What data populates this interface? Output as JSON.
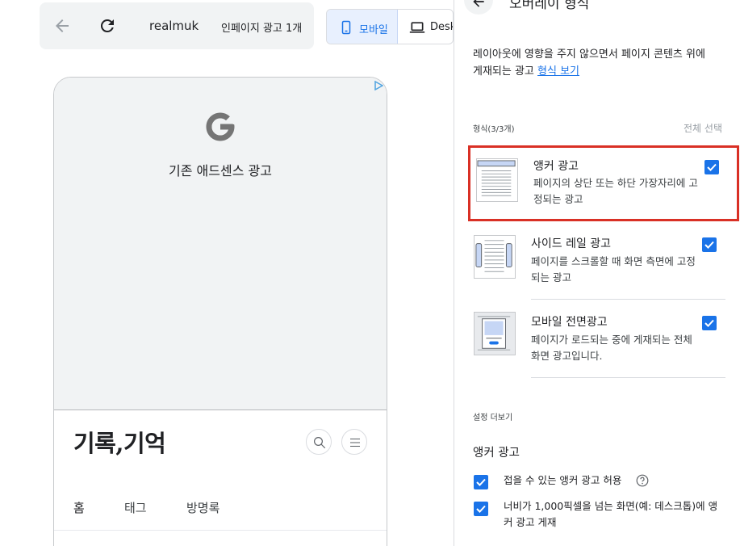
{
  "toolbar": {
    "site": "realmuk",
    "ad_count": "인페이지 광고 1개",
    "mobile_tab": "모바일",
    "desktop_tab": "Desk"
  },
  "preview": {
    "ad_label": "기존 애드센스 광고",
    "blog_title": "기록,기억",
    "nav": [
      "홈",
      "태그",
      "방명록"
    ]
  },
  "panel": {
    "title": "오버레이 형식",
    "desc_text": "레이아웃에 영향을 주지 않으면서 페이지 콘텐츠 위에 게재되는 광고",
    "desc_link": "형식 보기",
    "formats_count": "형식(3/3개)",
    "select_all": "전체 선택",
    "formats": [
      {
        "name": "앵커 광고",
        "desc": "페이지의 상단 또는 하단 가장자리에 고정되는 광고",
        "checked": true
      },
      {
        "name": "사이드 레일 광고",
        "desc": "페이지를 스크롤할 때 화면 측면에 고정되는 광고",
        "checked": true
      },
      {
        "name": "모바일 전면광고",
        "desc": "페이지가 로드되는 중에 게재되는 전체 화면 광고입니다.",
        "checked": true
      }
    ],
    "more_settings": "설정 더보기",
    "anchor_section": "앵커 광고",
    "options": [
      {
        "label": "접을 수 있는 앵커 광고 허용",
        "checked": true
      },
      {
        "label": "너비가 1,000픽셀을 넘는 화면(예: 데스크톱)에 앵커 광고 게재",
        "checked": true
      }
    ]
  },
  "colors": {
    "accent": "#1a73e8",
    "highlight": "#d93025"
  },
  "icons": [
    "back-arrow-icon",
    "reload-icon",
    "phone-icon",
    "laptop-icon",
    "google-g-icon",
    "adchoices-icon",
    "search-icon",
    "menu-icon",
    "help-icon",
    "checkbox-checked-icon"
  ]
}
